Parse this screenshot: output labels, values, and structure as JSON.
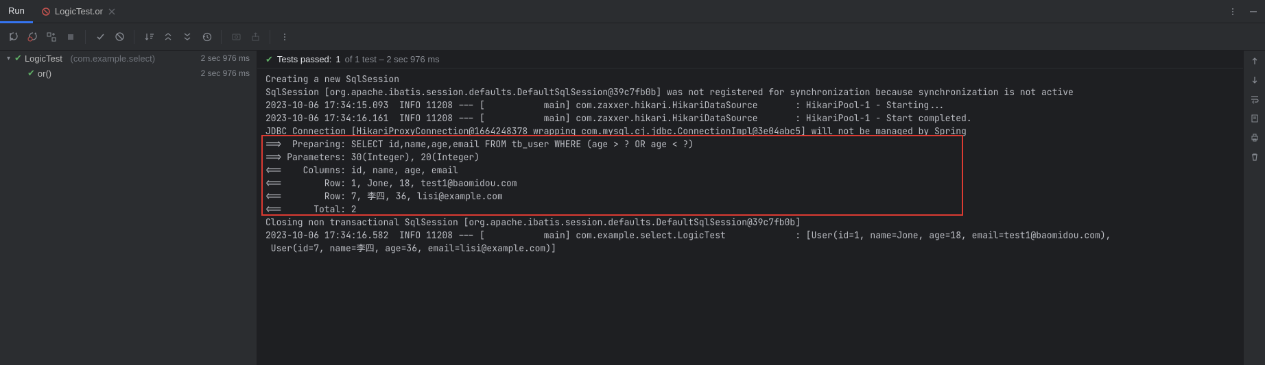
{
  "tabs": {
    "run": "Run",
    "file": "LogicTest.or"
  },
  "tree": {
    "root": {
      "name": "LogicTest",
      "pkg": "(com.example.select)",
      "dur": "2 sec 976 ms"
    },
    "child": {
      "name": "or()",
      "dur": "2 sec 976 ms"
    }
  },
  "status": {
    "prefix": "Tests passed:",
    "count": "1",
    "suffix": "of 1 test – 2 sec 976 ms"
  },
  "log": {
    "l0": "Creating a new SqlSession",
    "l1": "SqlSession [org.apache.ibatis.session.defaults.DefaultSqlSession@39c7fb0b] was not registered for synchronization because synchronization is not active",
    "l2": "2023-10-06 17:34:15.093  INFO 11208 --- [           main] com.zaxxer.hikari.HikariDataSource       : HikariPool-1 - Starting...",
    "l3": "2023-10-06 17:34:16.161  INFO 11208 --- [           main] com.zaxxer.hikari.HikariDataSource       : HikariPool-1 - Start completed.",
    "l4": "JDBC Connection [HikariProxyConnection@1664248378 wrapping com.mysql.cj.jdbc.ConnectionImpl@3e04abc5] will not be managed by Spring",
    "l5": "==>  Preparing: SELECT id,name,age,email FROM tb_user WHERE (age > ? OR age < ?)",
    "l6": "==> Parameters: 30(Integer), 20(Integer)",
    "l7": "<==    Columns: id, name, age, email",
    "l8": "<==        Row: 1, Jone, 18, test1@baomidou.com",
    "l9": "<==        Row: 7, 李四, 36, lisi@example.com",
    "l10": "<==      Total: 2",
    "l11": "Closing non transactional SqlSession [org.apache.ibatis.session.defaults.DefaultSqlSession@39c7fb0b]",
    "l12": "2023-10-06 17:34:16.582  INFO 11208 --- [           main] com.example.select.LogicTest             : [User(id=1, name=Jone, age=18, email=test1@baomidou.com),",
    "l13": " User(id=7, name=李四, age=36, email=lisi@example.com)]"
  }
}
